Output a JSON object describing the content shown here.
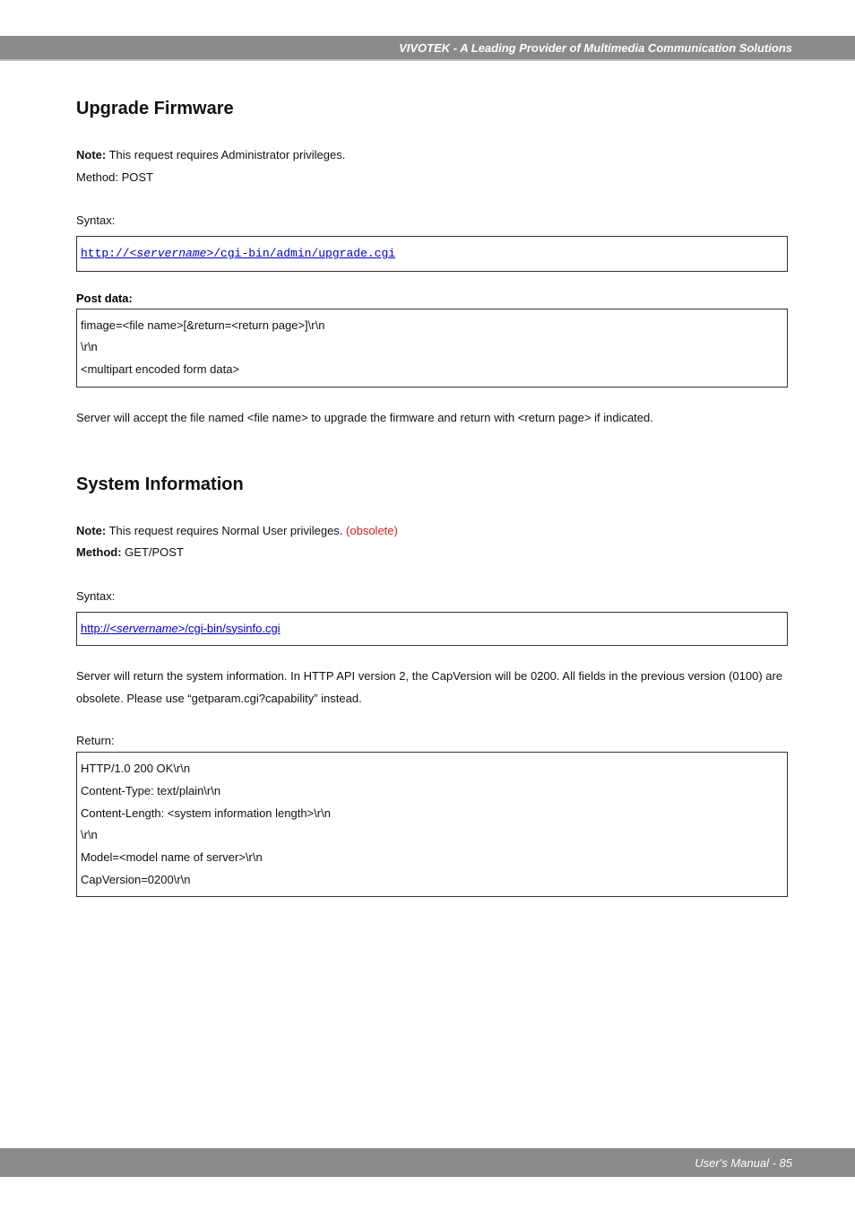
{
  "header": {
    "title": "VIVOTEK - A Leading Provider of Multimedia Communication Solutions"
  },
  "section1": {
    "title": "Upgrade Firmware",
    "note_label": "Note:",
    "note_text": " This request requires Administrator privileges.",
    "method_line": "Method: POST",
    "syntax_label": "Syntax:",
    "syntax_url_pre": "http://<",
    "syntax_url_ital": "servername",
    "syntax_url_post": ">/cgi-bin/admin/upgrade.cgi",
    "post_data_label": "Post data:",
    "post_data_line1": "fimage=<file name>[&return=<return page>]\\r\\n",
    "post_data_line2": "\\r\\n",
    "post_data_line3": "<multipart encoded form data>",
    "desc": "Server will accept the file named <file name> to upgrade the firmware and return with <return page> if indicated."
  },
  "section2": {
    "title": "System Information",
    "note_label": "Note:",
    "note_text": " This request requires Normal User privileges. ",
    "note_obsolete": "(obsolete)",
    "method_label": "Method:",
    "method_text": " GET/POST",
    "syntax_label": "Syntax:",
    "syntax_url_pre": "http://<",
    "syntax_url_ital": "servername",
    "syntax_url_post": ">/cgi-bin/sysinfo.cgi",
    "desc": "Server will return the system information. In HTTP API version 2, the CapVersion will be 0200. All fields in the previous version (0100) are obsolete. Please use “getparam.cgi?capability” instead.",
    "return_label": "Return:",
    "return_line1": "HTTP/1.0 200 OK\\r\\n",
    "return_line2": "Content-Type: text/plain\\r\\n",
    "return_line3": "Content-Length: <system information length>\\r\\n",
    "return_line4": "\\r\\n",
    "return_line5": "Model=<model name of server>\\r\\n",
    "return_line6": "CapVersion=0200\\r\\n"
  },
  "footer": {
    "text": "User's Manual - 85"
  }
}
